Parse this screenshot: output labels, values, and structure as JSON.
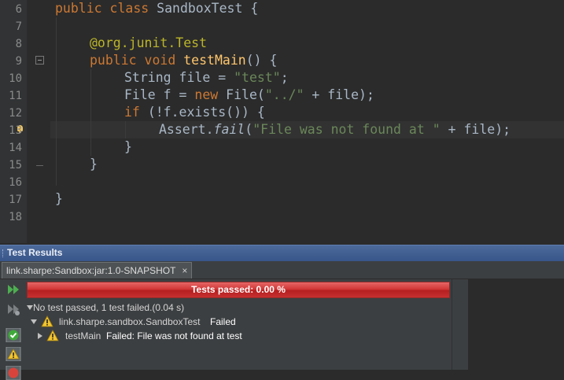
{
  "editor": {
    "line_numbers": [
      "6",
      "7",
      "8",
      "9",
      "10",
      "11",
      "12",
      "13",
      "14",
      "15",
      "16",
      "17",
      "18"
    ],
    "lines": {
      "l6": {
        "kw": "public class ",
        "name": "SandboxTest",
        "rest": " {"
      },
      "l8": {
        "ann": "@org.junit.Test"
      },
      "l9": {
        "kw": "public void ",
        "fn": "testMain",
        "rest": "() {"
      },
      "l10": {
        "pre": "String file = ",
        "str": "\"test\"",
        "post": ";"
      },
      "l11": {
        "pre": "File f = ",
        "kw": "new ",
        "mid": "File(",
        "str": "\"../\"",
        "post": " + file);"
      },
      "l12": {
        "kw": "if ",
        "rest": "(!f.exists()) {"
      },
      "l13": {
        "pre": "Assert.",
        "it": "fail",
        "mid": "(",
        "str": "\"File was not found at \"",
        "post": " + file);"
      },
      "l14": {
        "text": "}"
      },
      "l15": {
        "text": "}"
      },
      "l17": {
        "text": "}"
      }
    }
  },
  "tool_window": {
    "title": "Test Results",
    "tab_label": "link.sharpe:Sandbox:jar:1.0-SNAPSHOT",
    "tab_close": "×",
    "progress": {
      "label": "Tests passed: 0.00 %",
      "fraction": 1.0,
      "color": "#d23737"
    },
    "summary": "No test passed, 1 test failed.(0.04 s)",
    "tree": {
      "class_name": "link.sharpe.sandbox.SandboxTest",
      "class_status": "Failed",
      "method_name": "testMain",
      "method_status": "Failed: File was not found at test"
    },
    "toolbar_icons": [
      "rerun-icon",
      "rerun-failed-icon",
      "show-passed-icon",
      "show-ignored-icon",
      "stop-icon"
    ]
  },
  "colors": {
    "keyword": "#cc7832",
    "string": "#6a8759",
    "annotation": "#bbb529",
    "method": "#ffc66d",
    "text": "#a9b7c6",
    "failure": "#d23737"
  }
}
